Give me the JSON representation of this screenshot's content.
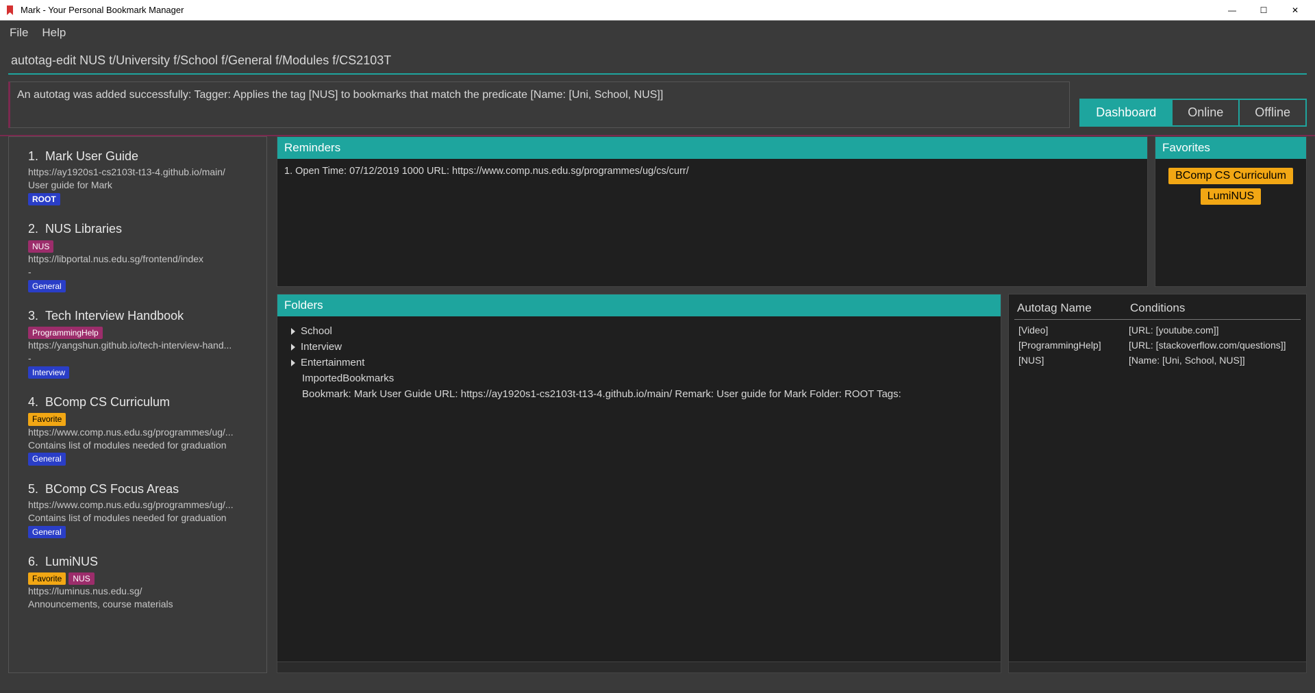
{
  "window": {
    "title": "Mark - Your Personal Bookmark Manager"
  },
  "menu": {
    "file": "File",
    "help": "Help"
  },
  "command": {
    "value": "autotag-edit NUS t/University f/School f/General f/Modules f/CS2103T"
  },
  "status": {
    "message": "An autotag was added successfully: Tagger: Applies the tag [NUS] to bookmarks that match the predicate [Name: [Uni, School, NUS]]"
  },
  "tabs": {
    "dashboard": "Dashboard",
    "online": "Online",
    "offline": "Offline"
  },
  "bookmarks": [
    {
      "num": "1.",
      "title": "Mark User Guide",
      "url": "https://ay1920s1-cs2103t-t13-4.github.io/main/",
      "desc": "User guide for Mark",
      "badges": [
        {
          "text": "ROOT",
          "cls": "root"
        }
      ]
    },
    {
      "num": "2.",
      "title": "NUS Libraries",
      "pre_badges": [
        {
          "text": "NUS",
          "cls": "nus"
        }
      ],
      "url": "https://libportal.nus.edu.sg/frontend/index",
      "desc": "-",
      "badges": [
        {
          "text": "General",
          "cls": "general"
        }
      ]
    },
    {
      "num": "3.",
      "title": "Tech Interview Handbook",
      "pre_badges": [
        {
          "text": "ProgrammingHelp",
          "cls": "proghelp"
        }
      ],
      "url": "https://yangshun.github.io/tech-interview-hand...",
      "desc": "-",
      "badges": [
        {
          "text": "Interview",
          "cls": "interview"
        }
      ]
    },
    {
      "num": "4.",
      "title": "BComp CS Curriculum",
      "pre_badges": [
        {
          "text": "Favorite",
          "cls": "favorite"
        }
      ],
      "url": "https://www.comp.nus.edu.sg/programmes/ug/...",
      "desc": "Contains list of modules needed for graduation",
      "badges": [
        {
          "text": "General",
          "cls": "general"
        }
      ]
    },
    {
      "num": "5.",
      "title": "BComp CS Focus Areas",
      "url": "https://www.comp.nus.edu.sg/programmes/ug/...",
      "desc": "Contains list of modules needed for graduation",
      "badges": [
        {
          "text": "General",
          "cls": "general"
        }
      ]
    },
    {
      "num": "6.",
      "title": "LumiNUS",
      "pre_badges": [
        {
          "text": "Favorite",
          "cls": "favorite"
        },
        {
          "text": "NUS",
          "cls": "nus"
        }
      ],
      "url": "https://luminus.nus.edu.sg/",
      "desc": "Announcements, course materials"
    }
  ],
  "reminders": {
    "header": "Reminders",
    "items": [
      "1. Open Time: 07/12/2019 1000 URL: https://www.comp.nus.edu.sg/programmes/ug/cs/curr/"
    ]
  },
  "favorites": {
    "header": "Favorites",
    "items": [
      "BComp CS Curriculum",
      "LumiNUS"
    ]
  },
  "folders": {
    "header": "Folders",
    "tree": [
      {
        "label": "School",
        "expandable": true
      },
      {
        "label": "Interview",
        "expandable": true
      },
      {
        "label": "Entertainment",
        "expandable": true
      },
      {
        "label": "ImportedBookmarks",
        "expandable": false
      },
      {
        "label": "Bookmark: Mark User Guide URL: https://ay1920s1-cs2103t-t13-4.github.io/main/ Remark: User guide for Mark Folder: ROOT Tags:",
        "expandable": false
      }
    ]
  },
  "autotags": {
    "header_name": "Autotag Name",
    "header_cond": "Conditions",
    "rows": [
      {
        "name": "[Video]",
        "cond": "[URL: [youtube.com]]"
      },
      {
        "name": "[ProgrammingHelp]",
        "cond": "[URL: [stackoverflow.com/questions]]"
      },
      {
        "name": "[NUS]",
        "cond": "[Name: [Uni, School, NUS]]"
      }
    ]
  }
}
